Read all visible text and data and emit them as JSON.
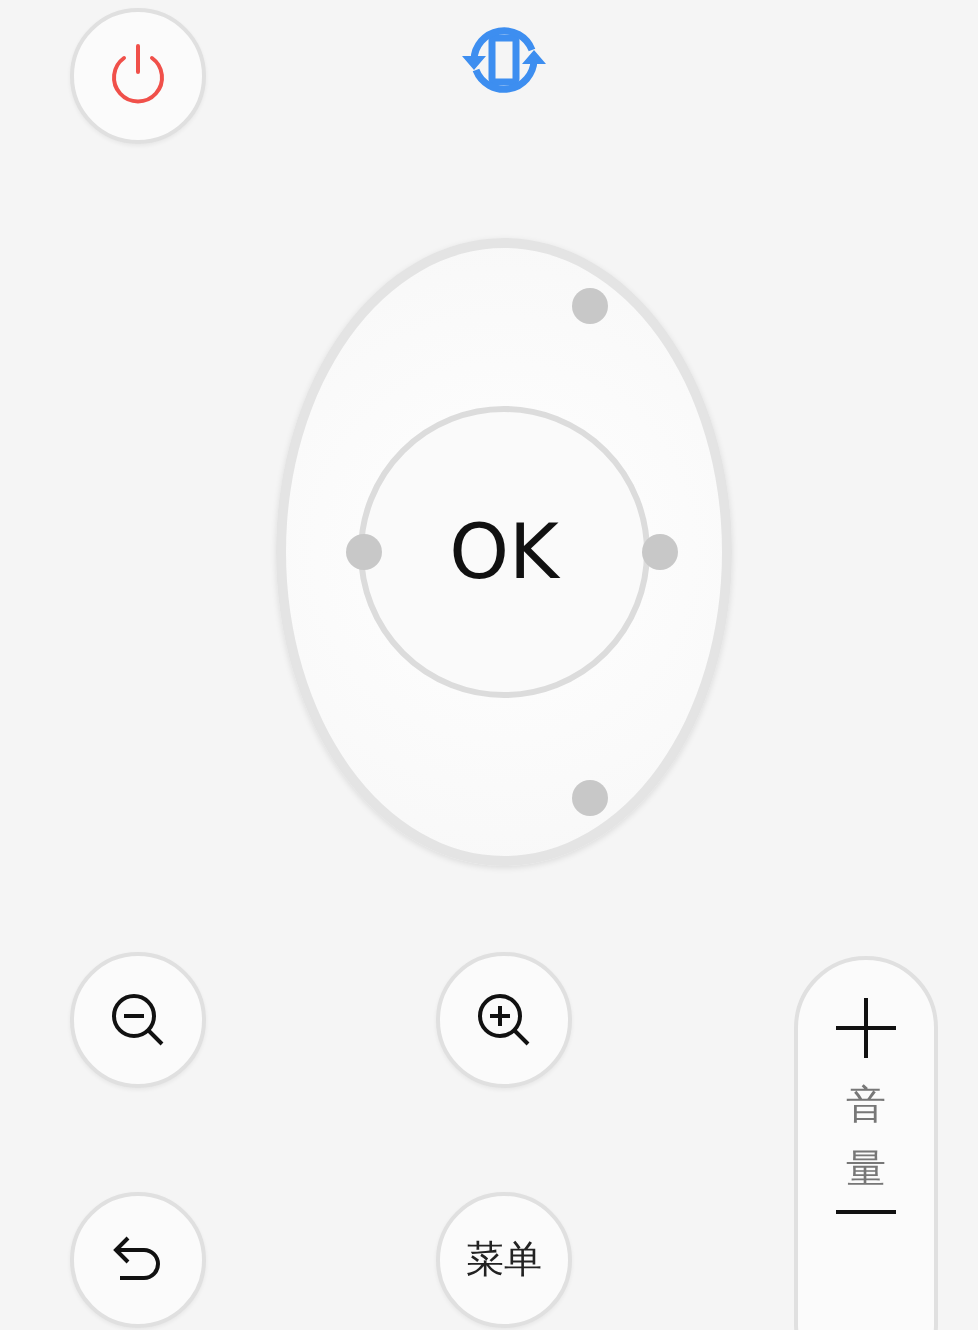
{
  "dpad": {
    "center_label": "OK"
  },
  "menu_button": {
    "label": "菜单"
  },
  "volume_control": {
    "label": "音量"
  }
}
